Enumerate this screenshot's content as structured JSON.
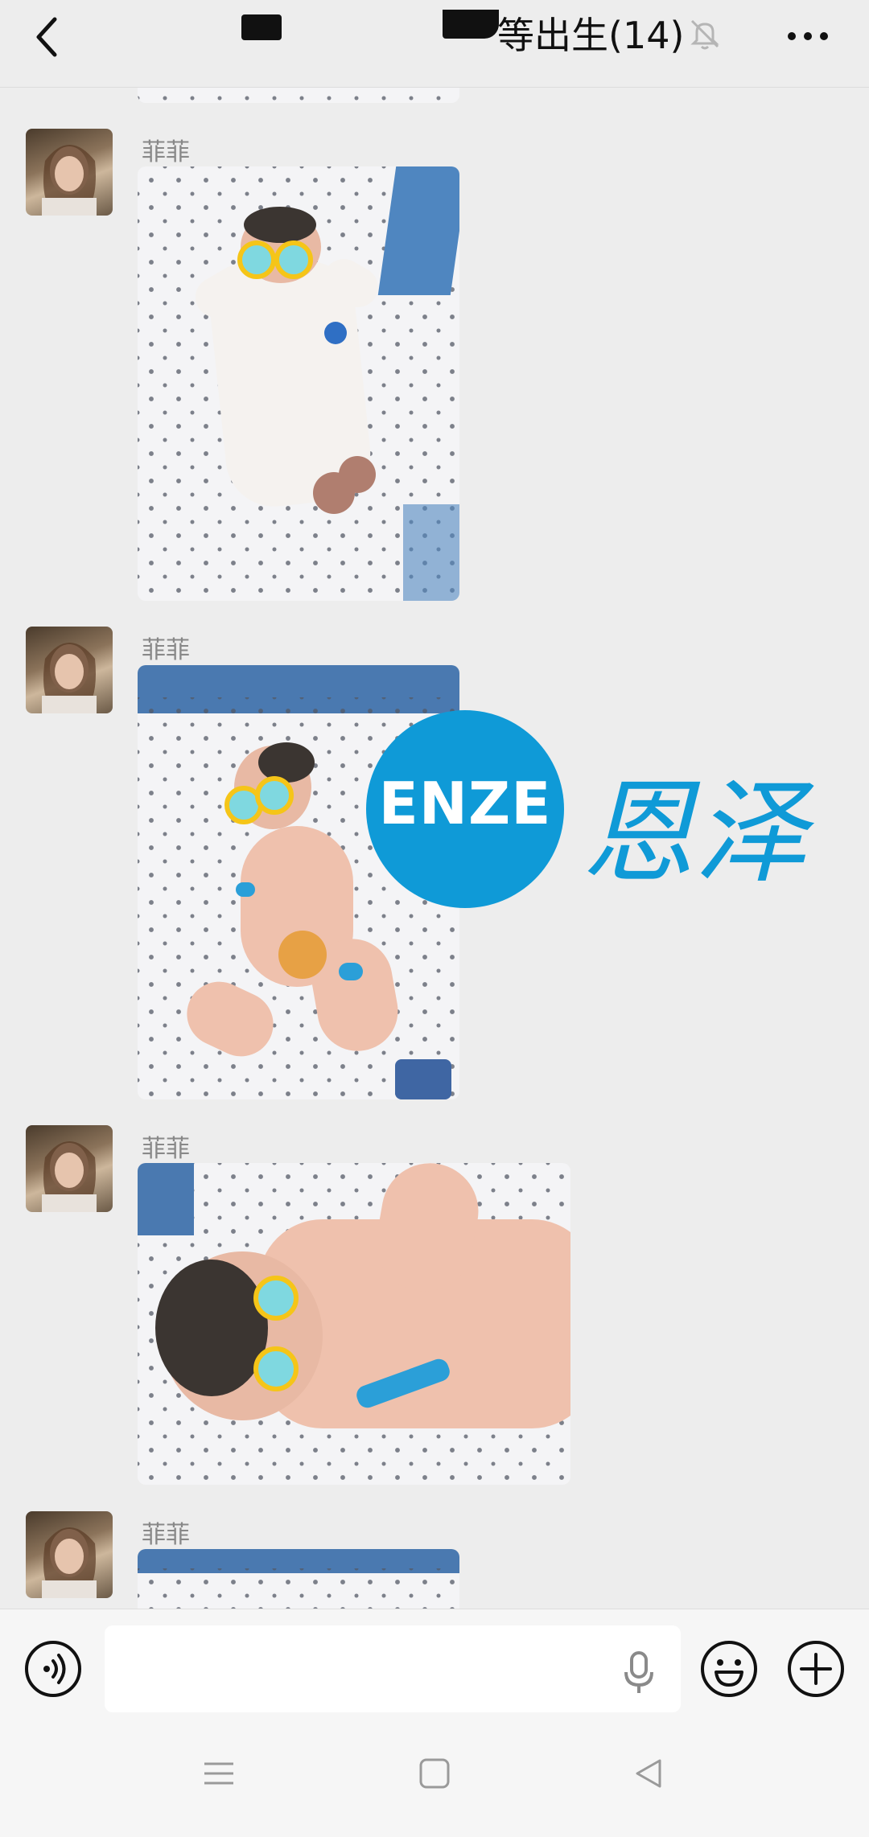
{
  "header": {
    "title": "等出生(14)",
    "back_icon": "chevron-left-icon",
    "mute_icon": "bell-off-icon",
    "more_icon": "more-horizontal-icon"
  },
  "messages": [
    {
      "sender": "菲菲"
    },
    {
      "sender": "菲菲"
    },
    {
      "sender": "菲菲"
    },
    {
      "sender": "菲菲"
    }
  ],
  "watermark": {
    "logo_text": "ENZE",
    "cn_text": "恩泽",
    "color": "#0f9ad7"
  },
  "input_bar": {
    "voice_icon": "voice-icon",
    "input_value": "",
    "mic_icon": "mic-icon",
    "emoji_icon": "emoji-icon",
    "plus_icon": "plus-icon"
  },
  "nav_bar": {
    "menu_icon": "menu-icon",
    "home_icon": "home-icon",
    "back_icon": "back-triangle-icon"
  }
}
